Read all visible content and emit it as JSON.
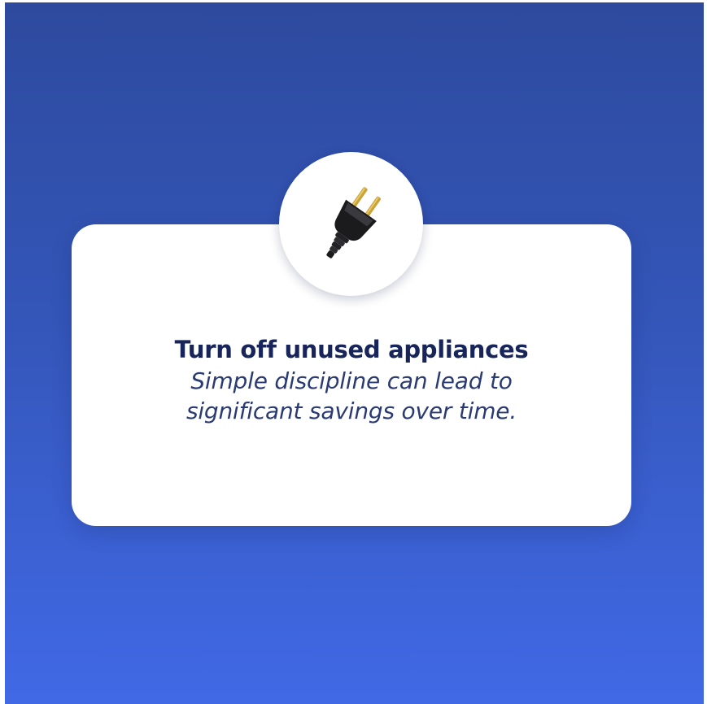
{
  "card": {
    "title": "Turn off unused appliances",
    "subtitle_line1": "Simple discipline can lead to",
    "subtitle_line2": "significant savings over time."
  },
  "icon": {
    "name": "power-plug-icon"
  },
  "colors": {
    "background_top": "#2d4a9e",
    "background_bottom": "#4169e6",
    "card": "#ffffff",
    "title_text": "#17255a"
  }
}
